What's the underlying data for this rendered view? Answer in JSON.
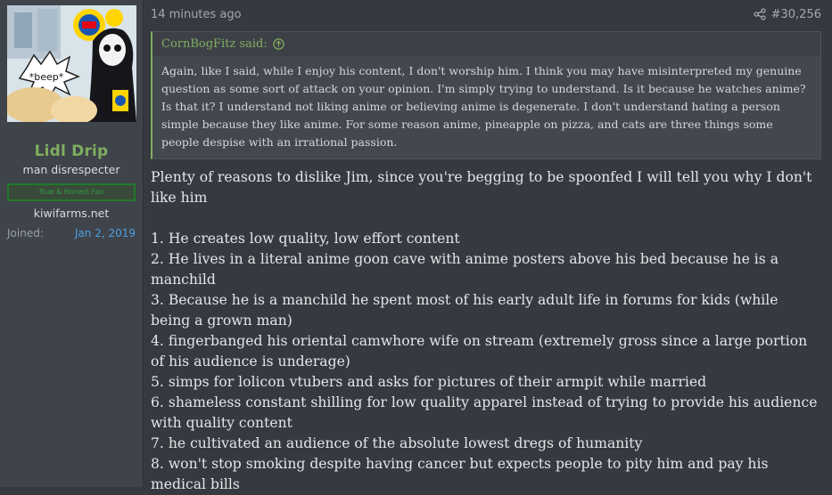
{
  "user": {
    "avatar_caption": "*beep*",
    "name": "Lidl Drip",
    "title": "man disrespecter",
    "banner": "True & Honest Fan",
    "site": "kiwifarms.net",
    "joined_label": "Joined:",
    "joined_date": "Jan 2, 2019"
  },
  "post": {
    "time": "14 minutes ago",
    "number": "#30,256",
    "quote": {
      "author": "CornBogFitz said:",
      "text": "Again, like I said, while I enjoy his content, I don't worship him. I think you may have misinterpreted my genuine question as some sort of attack on your opinion. I'm simply trying to understand. Is it because he watches anime? Is that it? I understand not liking anime or believing anime is degenerate. I don't understand hating a person simple because they like anime. For some reason anime, pineapple on pizza, and cats are three things some people despise with an irrational passion."
    },
    "intro": "Plenty of reasons to dislike Jim, since you're begging to be spoonfed I will tell you why I don't like him",
    "reasons": [
      "1. He creates low quality, low effort content",
      "2. He lives in a literal anime goon cave with anime posters above his bed because he is a manchild",
      "3. Because he is a manchild he spent most of his early adult life in forums for kids (while being a grown man)",
      "4. fingerbanged his oriental camwhore wife on stream (extremely gross since a large portion of his audience is underage)",
      "5. simps for lolicon vtubers and asks for pictures of their armpit while married",
      "6. shameless constant shilling for low quality apparel instead of trying to provide his audience with quality content",
      "7. he cultivated an audience of the absolute lowest dregs of humanity",
      "8. won't stop smoking despite having cancer but expects people to pity him and pay his medical bills"
    ]
  }
}
